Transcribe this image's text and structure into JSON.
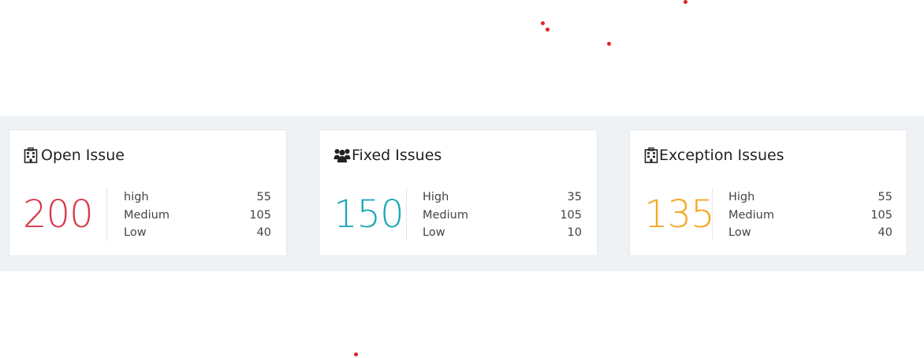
{
  "cards": [
    {
      "title": "Open Issue",
      "icon": "building-icon",
      "total": "200",
      "color": "#d73a4a",
      "rows": [
        {
          "label": "high",
          "value": "55"
        },
        {
          "label": "Medium",
          "value": "105"
        },
        {
          "label": "Low",
          "value": "40"
        }
      ]
    },
    {
      "title": "Fixed Issues",
      "icon": "users-icon",
      "total": "150",
      "color": "#20a8b8",
      "rows": [
        {
          "label": "High",
          "value": "35"
        },
        {
          "label": "Medium",
          "value": "105"
        },
        {
          "label": "Low",
          "value": "10"
        }
      ]
    },
    {
      "title": "Exception Issues",
      "icon": "building-icon",
      "total": "135",
      "color": "#f5a623",
      "rows": [
        {
          "label": "High",
          "value": "55"
        },
        {
          "label": "Medium",
          "value": "105"
        },
        {
          "label": "Low",
          "value": "40"
        }
      ]
    }
  ]
}
